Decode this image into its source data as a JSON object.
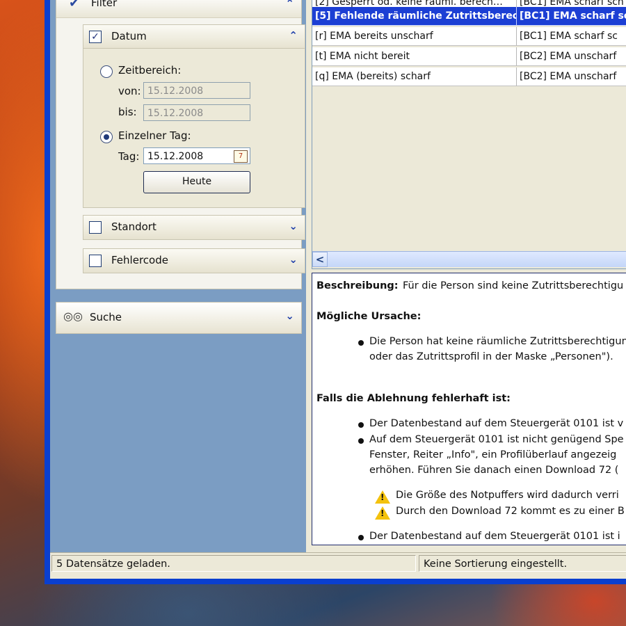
{
  "left": {
    "filter_title": "Filter",
    "datum": {
      "title": "Datum",
      "zeitbereich_label": "Zeitbereich:",
      "von_label": "von:",
      "von_value": "15.12.2008",
      "bis_label": "bis:",
      "bis_value": "15.12.2008",
      "einzelner_label": "Einzelner Tag:",
      "tag_label": "Tag:",
      "tag_value": "15.12.2008",
      "heute_button": "Heute"
    },
    "standort_label": "Standort",
    "fehlercode_label": "Fehlercode",
    "suche_label": "Suche"
  },
  "grid": {
    "rows": [
      {
        "col1": "[2] Gesperrt od. keine räuml. berech…",
        "col2": "[BC1] EMA scharf sch"
      },
      {
        "col1": "[5] Fehlende räumliche Zutrittsberec…",
        "col2": "[BC1] EMA scharf sch"
      },
      {
        "col1": "[r] EMA bereits unscharf",
        "col2": "[BC1] EMA scharf sc"
      },
      {
        "col1": "[t] EMA nicht bereit",
        "col2": "[BC2] EMA unscharf"
      },
      {
        "col1": "[q] EMA (bereits) scharf",
        "col2": "[BC2] EMA unscharf"
      }
    ],
    "scroll_left": "<"
  },
  "description": {
    "beschreibung_label": "Beschreibung:",
    "beschreibung_text": "Für die Person sind keine Zutrittsberechtigu",
    "ursache_heading": "Mögliche Ursache:",
    "ursache_line1": "Die Person hat keine räumliche Zutrittsberechtigun",
    "ursache_line2": "oder das Zutrittsprofil in der Maske „Personen\").",
    "falls_heading": "Falls die Ablehnung fehlerhaft ist:",
    "b1": "Der Datenbestand auf dem Steuergerät 0101 ist v",
    "b2_line1": "Auf dem Steuergerät 0101 ist nicht genügend Spe",
    "b2_line2": "Fenster, Reiter „Info\", ein Profilüberlauf angezeig",
    "b2_line3": "erhöhen. Führen Sie danach einen Download 72 (",
    "warn1": "Die Größe des Notpuffers wird dadurch verri",
    "warn2": "Durch den Download 72 kommt es zu einer B",
    "b3": "Der Datenbestand auf dem Steuergerät 0101 ist i"
  },
  "status": {
    "left": "5 Datensätze geladen.",
    "right": "Keine Sortierung eingestellt."
  }
}
